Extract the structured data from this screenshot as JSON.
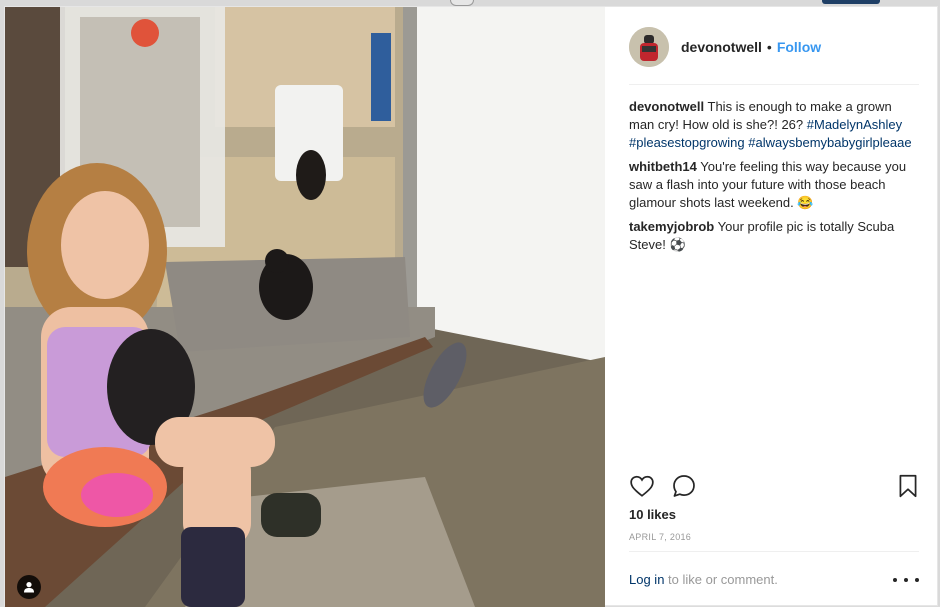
{
  "post": {
    "username": "devonotwell",
    "separator": "•",
    "follow_label": "Follow"
  },
  "caption": {
    "username": "devonotwell",
    "text": "This is enough to make a grown man cry! How old is she?! 26?",
    "hashtags": [
      "#MadelynAshley",
      "#pleasestopgrowing",
      "#alwaysbemybabygirlpleaae"
    ]
  },
  "comments": [
    {
      "username": "whitbeth14",
      "text": "You're feeling this way because you saw a flash into your future with those beach glamour shots last weekend. 😂"
    },
    {
      "username": "takemyjobrob",
      "text": "Your profile pic is totally Scuba Steve! ⚽"
    }
  ],
  "stats": {
    "likes": "10 likes",
    "date": "APRIL 7, 2016"
  },
  "footer": {
    "login_link": "Log in",
    "login_rest": " to like or comment."
  },
  "icons": {
    "like": "heart-icon",
    "comment": "comment-bubble-icon",
    "save": "bookmark-icon",
    "more": "more-options-icon",
    "tag": "user-tag-icon"
  },
  "colors": {
    "link_blue": "#3897f0",
    "hashtag_blue": "#003569",
    "text": "#262626",
    "muted": "#999999"
  }
}
